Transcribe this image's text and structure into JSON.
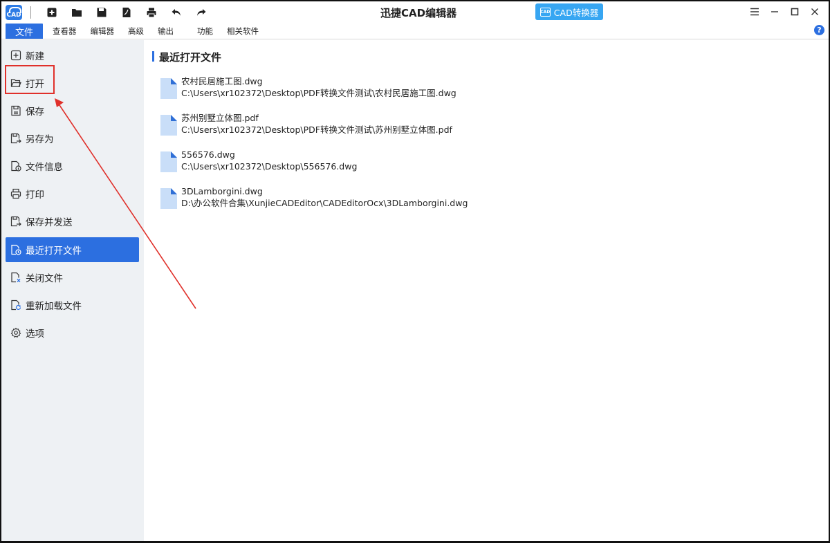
{
  "app": {
    "title": "迅捷CAD编辑器",
    "logo_text": "CAD",
    "converter_label": "CAD转换器",
    "converter_icon_text": "CAD"
  },
  "quick_access": [
    {
      "name": "new-file-icon"
    },
    {
      "name": "open-folder-icon"
    },
    {
      "name": "save-icon"
    },
    {
      "name": "export-pdf-icon"
    },
    {
      "name": "print-icon"
    },
    {
      "name": "undo-icon"
    },
    {
      "name": "redo-icon"
    }
  ],
  "menu": {
    "tabs": [
      "文件",
      "查看器",
      "编辑器",
      "高级",
      "输出",
      "功能",
      "相关软件"
    ],
    "active": "文件",
    "help": "?"
  },
  "sidebar": {
    "items": [
      {
        "label": "新建",
        "icon": "new-icon"
      },
      {
        "label": "打开",
        "icon": "open-icon"
      },
      {
        "label": "保存",
        "icon": "save-icon"
      },
      {
        "label": "另存为",
        "icon": "save-as-icon"
      },
      {
        "label": "文件信息",
        "icon": "file-info-icon"
      },
      {
        "label": "打印",
        "icon": "print-icon"
      },
      {
        "label": "保存并发送",
        "icon": "save-send-icon"
      },
      {
        "label": "最近打开文件",
        "icon": "recent-icon"
      },
      {
        "label": "关闭文件",
        "icon": "close-file-icon"
      },
      {
        "label": "重新加载文件",
        "icon": "reload-icon"
      },
      {
        "label": "选项",
        "icon": "options-gear-icon"
      }
    ],
    "active_index": 7
  },
  "main": {
    "title": "最近打开文件",
    "recent": [
      {
        "name": "农村民居施工图.dwg",
        "path": "C:\\Users\\xr102372\\Desktop\\PDF转换文件测试\\农村民居施工图.dwg"
      },
      {
        "name": "苏州别墅立体图.pdf",
        "path": "C:\\Users\\xr102372\\Desktop\\PDF转换文件测试\\苏州别墅立体图.pdf"
      },
      {
        "name": "556576.dwg",
        "path": "C:\\Users\\xr102372\\Desktop\\556576.dwg"
      },
      {
        "name": "3DLamborgini.dwg",
        "path": "D:\\办公软件合集\\XunjieCADEditor\\CADEditorOcx\\3DLamborgini.dwg"
      }
    ]
  },
  "colors": {
    "accent": "#2c6fe0",
    "converter": "#37a6f2",
    "sidebar_bg": "#eef1f4",
    "annotation_red": "#e0302a",
    "file_icon": "#c9def8"
  }
}
